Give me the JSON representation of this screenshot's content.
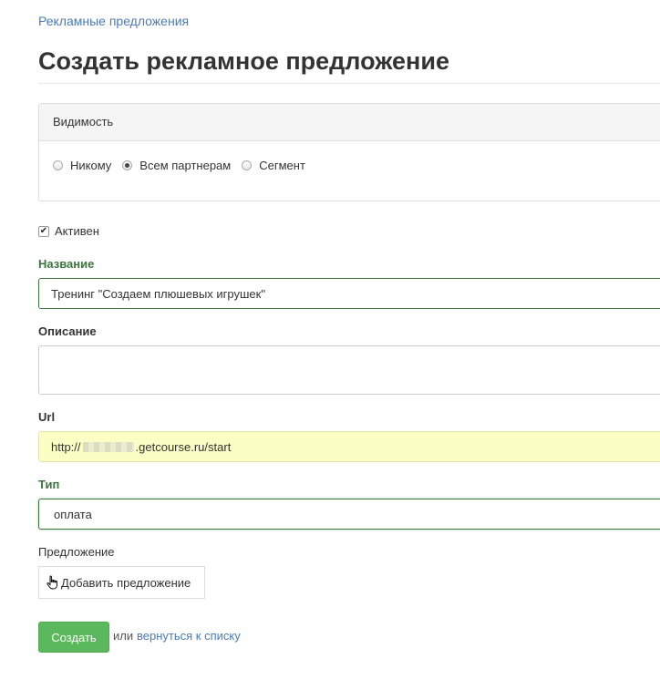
{
  "breadcrumb": "Рекламные предложения",
  "page_title": "Создать рекламное предложение",
  "visibility": {
    "header": "Видимость",
    "options": [
      {
        "label": "Никому",
        "checked": false
      },
      {
        "label": "Всем партнерам",
        "checked": true
      },
      {
        "label": "Сегмент",
        "checked": false
      }
    ]
  },
  "active": {
    "label": "Активен",
    "checked": true
  },
  "name": {
    "label": "Название",
    "value": "Тренинг \"Создаем плюшевых игрушек\""
  },
  "description": {
    "label": "Описание",
    "value": ""
  },
  "url": {
    "label": "Url",
    "value_prefix": "http://",
    "value_suffix": ".getcourse.ru/start"
  },
  "type": {
    "label": "Тип",
    "value": "оплата"
  },
  "offer": {
    "label": "Предложение",
    "add_button": "Добавить предложение"
  },
  "actions": {
    "submit": "Создать",
    "or": "или",
    "back": "вернуться к списку"
  },
  "colors": {
    "link": "#4a7bb5",
    "success": "#3c763d",
    "button": "#5cb85c",
    "url_bg": "#fcffc4"
  }
}
